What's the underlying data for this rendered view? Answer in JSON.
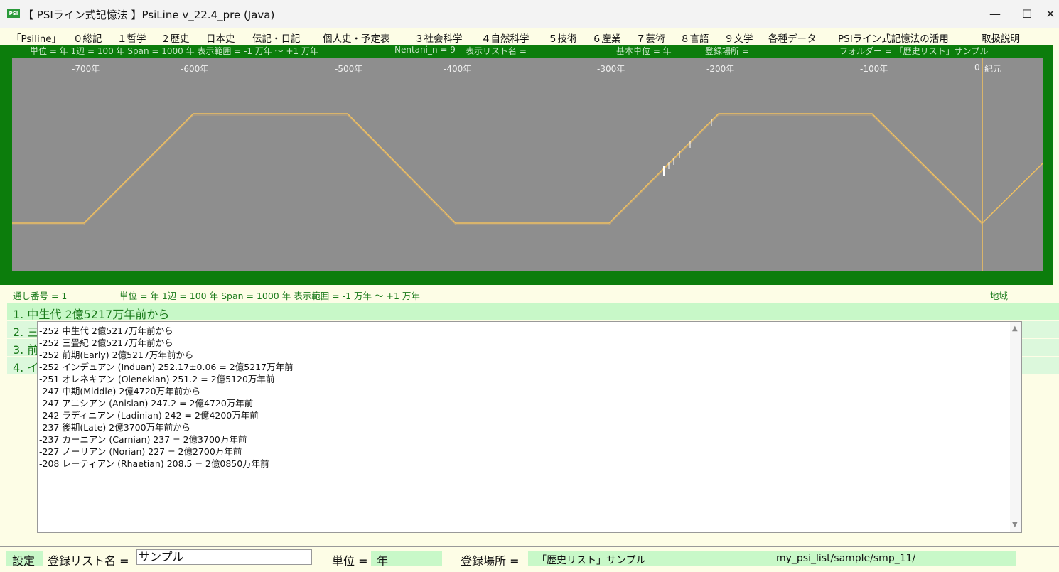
{
  "title_bar": {
    "icon": "PSI",
    "title": "【 PSIライン式記憶法 】PsiLine v_22.4_pre (Java)"
  },
  "menu": [
    "「Psiline」",
    "０総記",
    "１哲学",
    "２歴史",
    "日本史",
    "伝記・日記",
    "個人史・予定表",
    "３社会科学",
    "４自然科学",
    "５技術",
    "６産業",
    "７芸術",
    "８言語",
    "９文学",
    "各種データ",
    "PSIライン式記憶法の活用",
    "取扱説明"
  ],
  "top_info": {
    "unit": "単位 = 年  1辺 = 100 年  Span = 1000 年  表示範囲 = -1 万年 ～ +1 万年",
    "nentani": "Nentani_n = 9",
    "list_name": "表示リスト名 =",
    "base_unit": "基本単位 = 年",
    "location": "登録場所 =",
    "folder": "フォルダー = 「歴史リスト」サンプル"
  },
  "axis_ticks": [
    "-700年",
    "-600年",
    "-500年",
    "-400年",
    "-300年",
    "-200年",
    "-100年",
    "0",
    "紀元"
  ],
  "chart": {
    "line_color": "#f0c060",
    "bg_color": "#8e8e8e",
    "frame_color": "#0c7d0c"
  },
  "info_bar": {
    "serial": "通し番号 = 1",
    "unit": "単位 = 年  1辺 = 100 年  Span = 1000 年  表示範囲 = -1 万年 ～ +1 万年",
    "region": "地域"
  },
  "list_rows": [
    "1. 中生代 2億5217万年前から",
    "2. 三",
    "3. 前",
    "4. イ"
  ],
  "editor_lines": [
    "-252  中生代 2億5217万年前から",
    "-252  三畳紀 2億5217万年前から",
    "-252  前期(Early) 2億5217万年前から",
    "-252  インデュアン (Induan) 252.17±0.06 = 2億5217万年前",
    "-251  オレネキアン (Olenekian) 251.2 = 2億5120万年前",
    "-247  中期(Middle) 2億4720万年前から",
    "-247  アニシアン (Anisian) 247.2 = 2億4720万年前",
    "-242  ラディニアン (Ladinian) 242 = 2億4200万年前",
    "-237  後期(Late) 2億3700万年前から",
    "-237  カーニアン (Carnian) 237 = 2億3700万年前",
    "-227  ノーリアン (Norian) 227 = 2億2700万年前",
    "-208  レーティアン (Rhaetian) 208.5 = 2億0850万年前"
  ],
  "bottom": {
    "settings": "設定",
    "list_name_label": "登録リスト名 =",
    "list_name_value": "サンプル",
    "unit_label": "単位 =",
    "unit_value": "年",
    "location_label": "登録場所 =",
    "location_value": "「歴史リスト」サンプル",
    "path": "my_psi_list/sample/smp_11/"
  }
}
